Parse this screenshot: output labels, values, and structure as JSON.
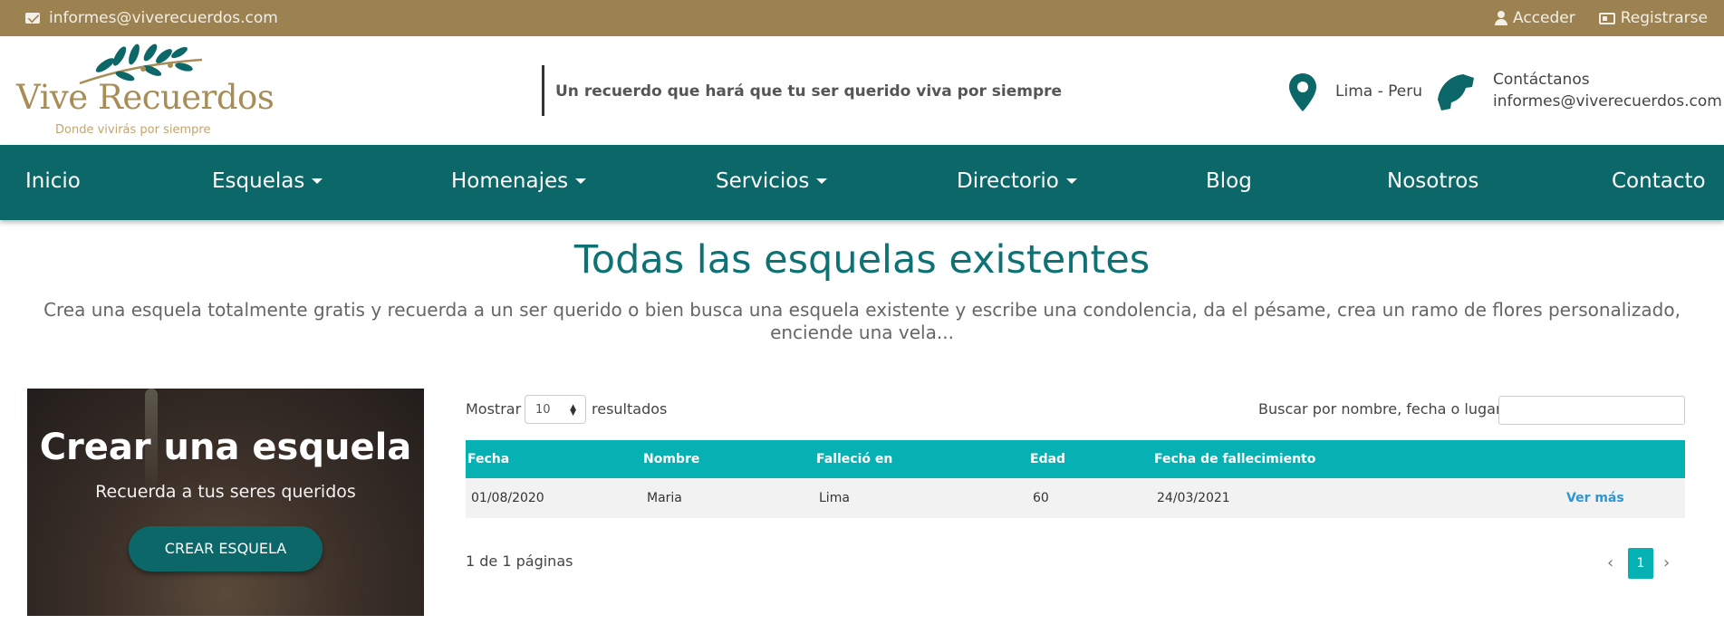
{
  "topbar": {
    "email": "informes@viverecuerdos.com",
    "login": "Acceder",
    "register": "Registrarse"
  },
  "header": {
    "logo_name": "Vive Recuerdos",
    "logo_tagline": "Donde vivirás por siempre",
    "tagline": "Un recuerdo que hará que tu ser querido viva por siempre",
    "location": "Lima - Peru",
    "contact_label": "Contáctanos",
    "contact_email": "informes@viverecuerdos.com"
  },
  "nav": {
    "items": [
      "Inicio",
      "Esquelas",
      "Homenajes",
      "Servicios",
      "Directorio",
      "Blog",
      "Nosotros",
      "Contacto"
    ]
  },
  "page": {
    "title": "Todas las esquelas existentes",
    "subtitle": "Crea una esquela totalmente gratis y recuerda a un ser querido o bien busca una esquela existente y escribe una condolencia, da el pésame, crea un ramo de flores personalizado, enciende una vela..."
  },
  "promo": {
    "title": "Crear una esquela",
    "subtitle": "Recuerda a tus seres queridos",
    "button": "CREAR ESQUELA"
  },
  "table": {
    "show_label": "Mostrar",
    "page_size": "10",
    "show_suffix": "resultados",
    "search_label": "Buscar por nombre, fecha o lugar",
    "search_value": "",
    "columns": [
      "Fecha",
      "Nombre",
      "Falleció en",
      "Edad",
      "Fecha de fallecimiento"
    ],
    "rows": [
      {
        "fecha": "01/08/2020",
        "nombre": "Maria",
        "fallecio_en": "Lima",
        "edad": "60",
        "fecha_fallecimiento": "24/03/2021",
        "action": "Ver más"
      }
    ],
    "pages_info": "1 de 1 páginas",
    "current_page": "1"
  },
  "colors": {
    "topbar": "#9c8250",
    "nav": "#0c6768",
    "title": "#0e7274",
    "table_header": "#06b1b4",
    "link": "#2c96d6"
  }
}
